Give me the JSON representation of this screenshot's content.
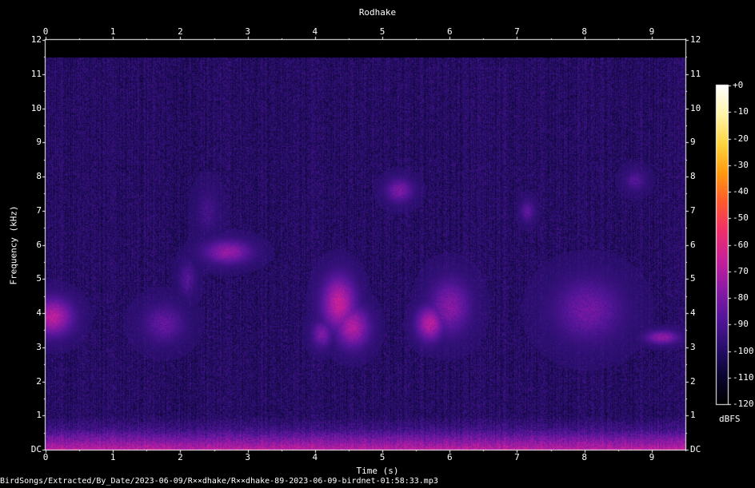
{
  "chart_data": {
    "type": "heatmap",
    "title": "Rodhake",
    "xlabel": "Time (s)",
    "ylabel": "Frequency (kHz)",
    "xlim": [
      0,
      9.5
    ],
    "ylim": [
      0,
      12
    ],
    "x_ticks": [
      "0",
      "1",
      "2",
      "3",
      "4",
      "5",
      "6",
      "7",
      "8",
      "9"
    ],
    "y_ticks": [
      "DC",
      "1",
      "2",
      "3",
      "4",
      "5",
      "6",
      "7",
      "8",
      "9",
      "10",
      "11",
      "12"
    ],
    "colorbar": {
      "label": "dBFS",
      "range": [
        -120,
        0
      ],
      "ticks": [
        "+0",
        "-10",
        "-20",
        "-30",
        "-40",
        "-50",
        "-60",
        "-70",
        "-80",
        "-90",
        "-100",
        "-110",
        "-120"
      ],
      "colors": [
        "#000000",
        "#0a0530",
        "#2a0f6e",
        "#55169a",
        "#8c1aa6",
        "#c8209a",
        "#f0306a",
        "#ff5a2e",
        "#ff9a10",
        "#ffd540",
        "#fff5a8",
        "#ffffff"
      ]
    },
    "background_level_dbfs": -100,
    "high_cutoff_khz": 11.5,
    "calls": [
      {
        "t": 0.1,
        "f": 3.9,
        "dt": 0.3,
        "df": 0.55,
        "db": -68
      },
      {
        "t": 1.75,
        "f": 3.7,
        "dt": 0.3,
        "df": 0.55,
        "db": -85
      },
      {
        "t": 2.1,
        "f": 5.0,
        "dt": 0.12,
        "df": 0.5,
        "db": -88
      },
      {
        "t": 2.7,
        "f": 5.8,
        "dt": 0.35,
        "df": 0.35,
        "db": -75
      },
      {
        "t": 2.4,
        "f": 7.0,
        "dt": 0.15,
        "df": 0.6,
        "db": -92
      },
      {
        "t": 4.35,
        "f": 4.3,
        "dt": 0.25,
        "df": 0.8,
        "db": -66
      },
      {
        "t": 4.55,
        "f": 3.6,
        "dt": 0.25,
        "df": 0.6,
        "db": -70
      },
      {
        "t": 4.1,
        "f": 3.4,
        "dt": 0.15,
        "df": 0.4,
        "db": -80
      },
      {
        "t": 5.25,
        "f": 7.6,
        "dt": 0.2,
        "df": 0.35,
        "db": -80
      },
      {
        "t": 5.7,
        "f": 3.7,
        "dt": 0.2,
        "df": 0.5,
        "db": -68
      },
      {
        "t": 6.0,
        "f": 4.2,
        "dt": 0.3,
        "df": 0.8,
        "db": -78
      },
      {
        "t": 7.15,
        "f": 7.0,
        "dt": 0.1,
        "df": 0.3,
        "db": -85
      },
      {
        "t": 8.05,
        "f": 4.1,
        "dt": 0.5,
        "df": 0.9,
        "db": -82
      },
      {
        "t": 8.75,
        "f": 7.9,
        "dt": 0.15,
        "df": 0.3,
        "db": -88
      },
      {
        "t": 9.15,
        "f": 3.3,
        "dt": 0.25,
        "df": 0.2,
        "db": -76
      }
    ]
  },
  "footer": {
    "filename": "BirdSongs/Extracted/By_Date/2023-06-09/R××dhake/R××dhake-89-2023-06-09-birdnet-01:58:33.mp3"
  }
}
